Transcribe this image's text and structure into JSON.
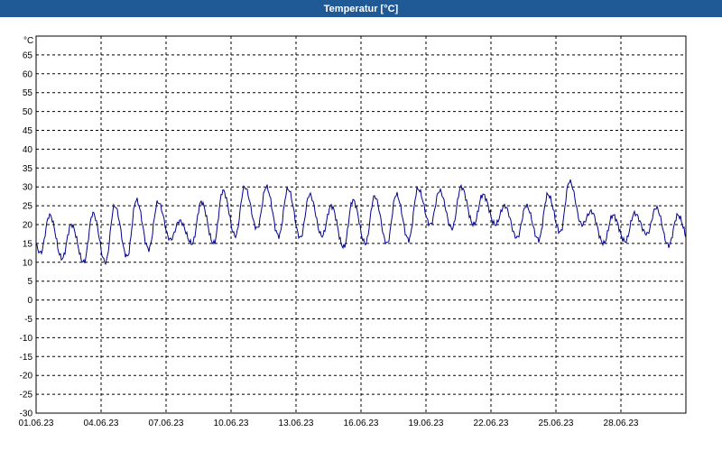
{
  "window": {
    "title": "Temperatur [°C]"
  },
  "chart_data": {
    "type": "line",
    "title": "Temperatur [°C]",
    "ylabel": "°C",
    "xlabel": "",
    "ylim": [
      -30,
      70
    ],
    "yticks": [
      -30,
      -25,
      -20,
      -15,
      -10,
      -5,
      0,
      5,
      10,
      15,
      20,
      25,
      30,
      35,
      40,
      45,
      50,
      55,
      60,
      65
    ],
    "xlim": [
      "2023-06-01",
      "2023-07-01"
    ],
    "xtick_labels": [
      "01.06.23",
      "04.06.23",
      "07.06.23",
      "10.06.23",
      "13.06.23",
      "16.06.23",
      "19.06.23",
      "22.06.23",
      "25.06.23",
      "28.06.23"
    ],
    "xtick_dates": [
      "2023-06-01",
      "2023-06-04",
      "2023-06-07",
      "2023-06-10",
      "2023-06-13",
      "2023-06-16",
      "2023-06-19",
      "2023-06-22",
      "2023-06-25",
      "2023-06-28"
    ],
    "grid": true,
    "line_color": "#00008b",
    "daily": [
      {
        "date": "2023-06-01",
        "min": 12.5,
        "max": 22.5
      },
      {
        "date": "2023-06-02",
        "min": 11.0,
        "max": 20.0
      },
      {
        "date": "2023-06-03",
        "min": 10.0,
        "max": 23.0
      },
      {
        "date": "2023-06-04",
        "min": 10.0,
        "max": 25.0
      },
      {
        "date": "2023-06-05",
        "min": 11.5,
        "max": 26.5
      },
      {
        "date": "2023-06-06",
        "min": 13.5,
        "max": 26.0
      },
      {
        "date": "2023-06-07",
        "min": 16.0,
        "max": 21.0
      },
      {
        "date": "2023-06-08",
        "min": 15.0,
        "max": 26.0
      },
      {
        "date": "2023-06-09",
        "min": 15.0,
        "max": 29.0
      },
      {
        "date": "2023-06-10",
        "min": 17.0,
        "max": 30.0
      },
      {
        "date": "2023-06-11",
        "min": 19.0,
        "max": 30.0
      },
      {
        "date": "2023-06-12",
        "min": 17.0,
        "max": 29.5
      },
      {
        "date": "2023-06-13",
        "min": 16.5,
        "max": 28.0
      },
      {
        "date": "2023-06-14",
        "min": 17.0,
        "max": 25.0
      },
      {
        "date": "2023-06-15",
        "min": 14.0,
        "max": 26.5
      },
      {
        "date": "2023-06-16",
        "min": 15.0,
        "max": 27.5
      },
      {
        "date": "2023-06-17",
        "min": 15.0,
        "max": 28.0
      },
      {
        "date": "2023-06-18",
        "min": 16.0,
        "max": 29.5
      },
      {
        "date": "2023-06-19",
        "min": 20.0,
        "max": 29.0
      },
      {
        "date": "2023-06-20",
        "min": 19.0,
        "max": 30.0
      },
      {
        "date": "2023-06-21",
        "min": 20.0,
        "max": 28.0
      },
      {
        "date": "2023-06-22",
        "min": 20.0,
        "max": 25.0
      },
      {
        "date": "2023-06-23",
        "min": 16.5,
        "max": 25.0
      },
      {
        "date": "2023-06-24",
        "min": 16.0,
        "max": 28.0
      },
      {
        "date": "2023-06-25",
        "min": 18.0,
        "max": 31.5
      },
      {
        "date": "2023-06-26",
        "min": 20.0,
        "max": 23.5
      },
      {
        "date": "2023-06-27",
        "min": 15.0,
        "max": 22.5
      },
      {
        "date": "2023-06-28",
        "min": 15.5,
        "max": 23.0
      },
      {
        "date": "2023-06-29",
        "min": 17.5,
        "max": 24.5
      },
      {
        "date": "2023-06-30",
        "min": 14.5,
        "max": 22.5
      }
    ]
  }
}
